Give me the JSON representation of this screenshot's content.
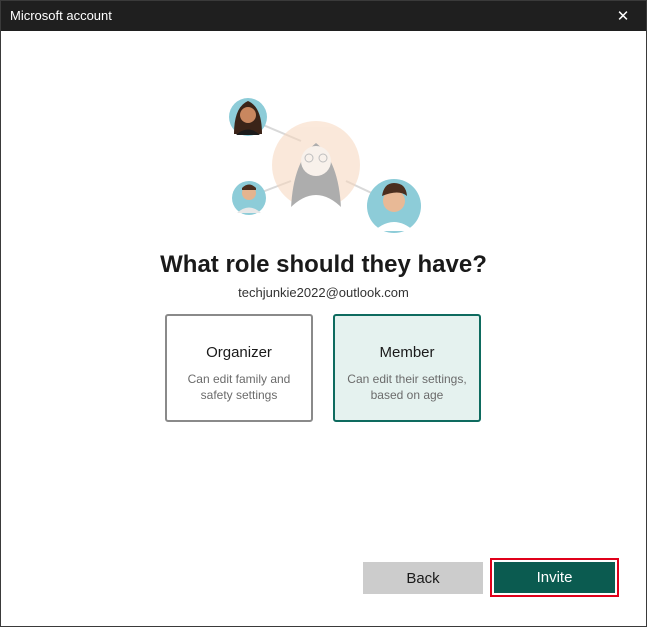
{
  "window": {
    "title": "Microsoft account",
    "close_symbol": "✕"
  },
  "heading": "What role should they have?",
  "email": "techjunkie2022@outlook.com",
  "roles": [
    {
      "title": "Organizer",
      "description": "Can edit family and safety settings",
      "selected": false
    },
    {
      "title": "Member",
      "description": "Can edit their settings, based on age",
      "selected": true
    }
  ],
  "buttons": {
    "back": "Back",
    "invite": "Invite"
  },
  "colors": {
    "accent": "#0b5b50",
    "selected_border": "#0e6b5f",
    "selected_fill": "#e5f2ef",
    "highlight": "#e0001a"
  },
  "illustration": {
    "icon": "family-people-icon"
  }
}
